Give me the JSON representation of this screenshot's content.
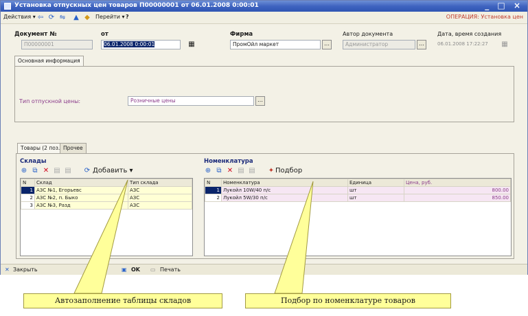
{
  "window": {
    "title": "Установка отпускных цен товаров П00000001 от 06.01.2008 0:00:01",
    "controls": "_ □ ×"
  },
  "toolbar": {
    "actions_label": "Действия ▾",
    "goto_label": "Перейти ▾",
    "help_label": "?",
    "operation_label": "ОПЕРАЦИЯ: Установка цен"
  },
  "header": {
    "doc_number_label": "Документ №",
    "doc_number_value": "П00000001",
    "date_from_label": "от",
    "date_value": "06.01.2008 0:00:01",
    "firm_label": "Фирма",
    "firm_value": "ПромОйл маркет",
    "author_label": "Автор документа",
    "author_value": "Администратор",
    "created_label": "Дата, время создания",
    "created_value": "06.01.2008 17:22:27"
  },
  "main_tab": {
    "label": "Основная информация",
    "price_type_label": "Тип отпускной цены:",
    "price_type_value": "Розничные цены"
  },
  "bottom_tabs": [
    {
      "label": "Товары (2 поз.)"
    },
    {
      "label": "Прочее"
    }
  ],
  "warehouses": {
    "title": "Склады",
    "add_label": "Добавить ▾",
    "columns": [
      "N",
      "Склад",
      "Тип склада"
    ],
    "rows": [
      {
        "n": "1",
        "name": "АЗС №1, Егорьевс",
        "type": "АЗС"
      },
      {
        "n": "2",
        "name": "АЗС №2, п. Быко",
        "type": "АЗС"
      },
      {
        "n": "3",
        "name": "АЗС №3, Разд",
        "type": "АЗС"
      }
    ]
  },
  "nomenclature": {
    "title": "Номенклатура",
    "select_label": "Подбор",
    "columns": [
      "N",
      "Номенклатура",
      "Единица",
      "Цена, руб."
    ],
    "rows": [
      {
        "n": "1",
        "name": "Лукойл 10W/40 п/с",
        "unit": "шт",
        "price": "800.00"
      },
      {
        "n": "2",
        "name": "Лукойл 5W/30 п/с",
        "unit": "шт",
        "price": "850.00"
      }
    ]
  },
  "footer": {
    "close_label": "Закрыть",
    "ok_label": "OK",
    "print_label": "Печать"
  },
  "callouts": {
    "left": "Автозаполнение таблицы складов",
    "right": "Подбор по номенклатуре товаров"
  },
  "colors": {
    "title_bar": "#3f64c0",
    "window_bg": "#f3f1e6",
    "callout_bg": "#ffff9a",
    "operation_text": "#c0392b",
    "price_column_text": "#8a3a8a"
  }
}
